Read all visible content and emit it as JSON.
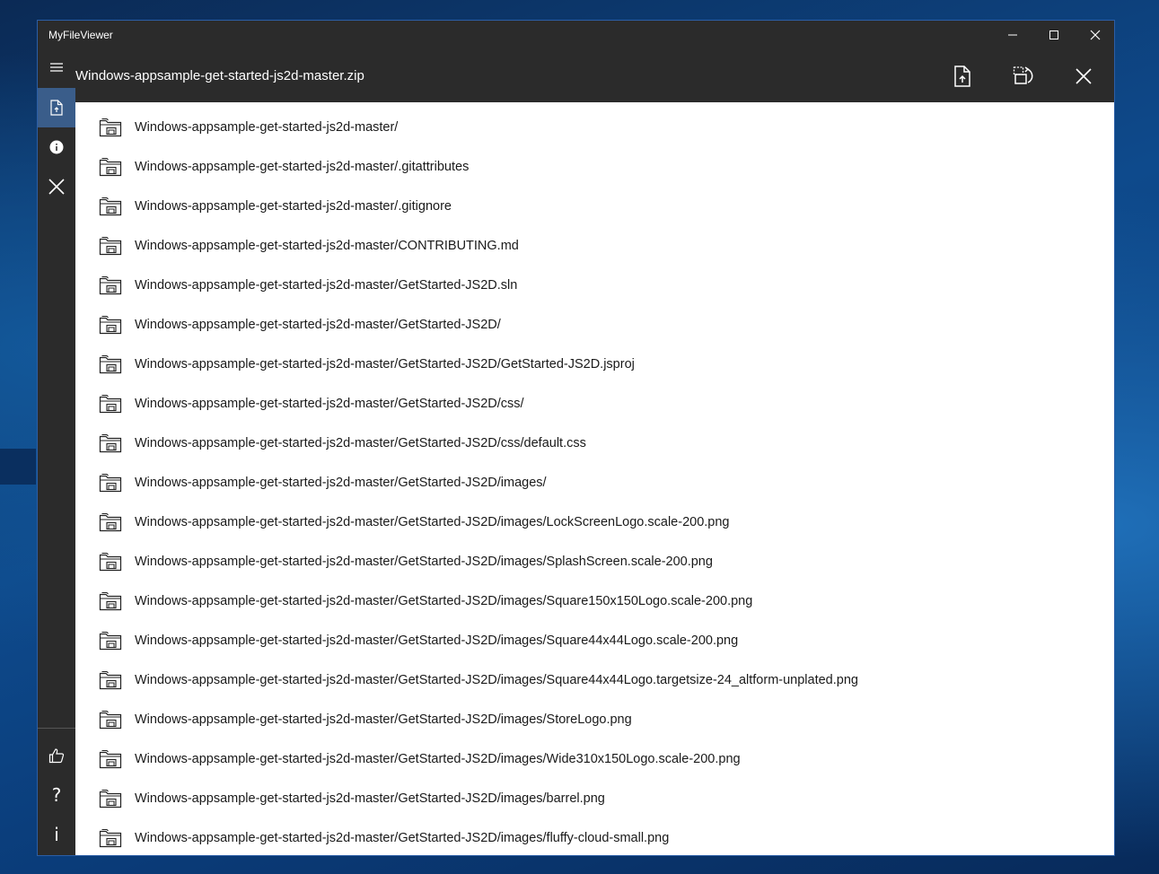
{
  "app": {
    "title": "MyFileViewer"
  },
  "window_controls": {
    "minimize": "minimize-icon",
    "maximize": "maximize-icon",
    "close": "close-icon"
  },
  "header": {
    "title": "Windows-appsample-get-started-js2d-master.zip",
    "actions": [
      "open-file-icon",
      "extract-icon",
      "close-icon"
    ]
  },
  "sidebar": {
    "top_items": [
      "open-file-icon",
      "info-icon",
      "close-icon"
    ],
    "bottom_items": [
      {
        "icon": "thumbs-up-icon",
        "glyph": ""
      },
      {
        "icon": "help-icon",
        "glyph": "?"
      },
      {
        "icon": "about-icon",
        "glyph": "i"
      }
    ]
  },
  "files": [
    "Windows-appsample-get-started-js2d-master/",
    "Windows-appsample-get-started-js2d-master/.gitattributes",
    "Windows-appsample-get-started-js2d-master/.gitignore",
    "Windows-appsample-get-started-js2d-master/CONTRIBUTING.md",
    "Windows-appsample-get-started-js2d-master/GetStarted-JS2D.sln",
    "Windows-appsample-get-started-js2d-master/GetStarted-JS2D/",
    "Windows-appsample-get-started-js2d-master/GetStarted-JS2D/GetStarted-JS2D.jsproj",
    "Windows-appsample-get-started-js2d-master/GetStarted-JS2D/css/",
    "Windows-appsample-get-started-js2d-master/GetStarted-JS2D/css/default.css",
    "Windows-appsample-get-started-js2d-master/GetStarted-JS2D/images/",
    "Windows-appsample-get-started-js2d-master/GetStarted-JS2D/images/LockScreenLogo.scale-200.png",
    "Windows-appsample-get-started-js2d-master/GetStarted-JS2D/images/SplashScreen.scale-200.png",
    "Windows-appsample-get-started-js2d-master/GetStarted-JS2D/images/Square150x150Logo.scale-200.png",
    "Windows-appsample-get-started-js2d-master/GetStarted-JS2D/images/Square44x44Logo.scale-200.png",
    "Windows-appsample-get-started-js2d-master/GetStarted-JS2D/images/Square44x44Logo.targetsize-24_altform-unplated.png",
    "Windows-appsample-get-started-js2d-master/GetStarted-JS2D/images/StoreLogo.png",
    "Windows-appsample-get-started-js2d-master/GetStarted-JS2D/images/Wide310x150Logo.scale-200.png",
    "Windows-appsample-get-started-js2d-master/GetStarted-JS2D/images/barrel.png",
    "Windows-appsample-get-started-js2d-master/GetStarted-JS2D/images/fluffy-cloud-small.png"
  ],
  "colors": {
    "chrome": "#2b2b2b",
    "accent": "#3a5d8a",
    "border": "#2b5ea6"
  }
}
